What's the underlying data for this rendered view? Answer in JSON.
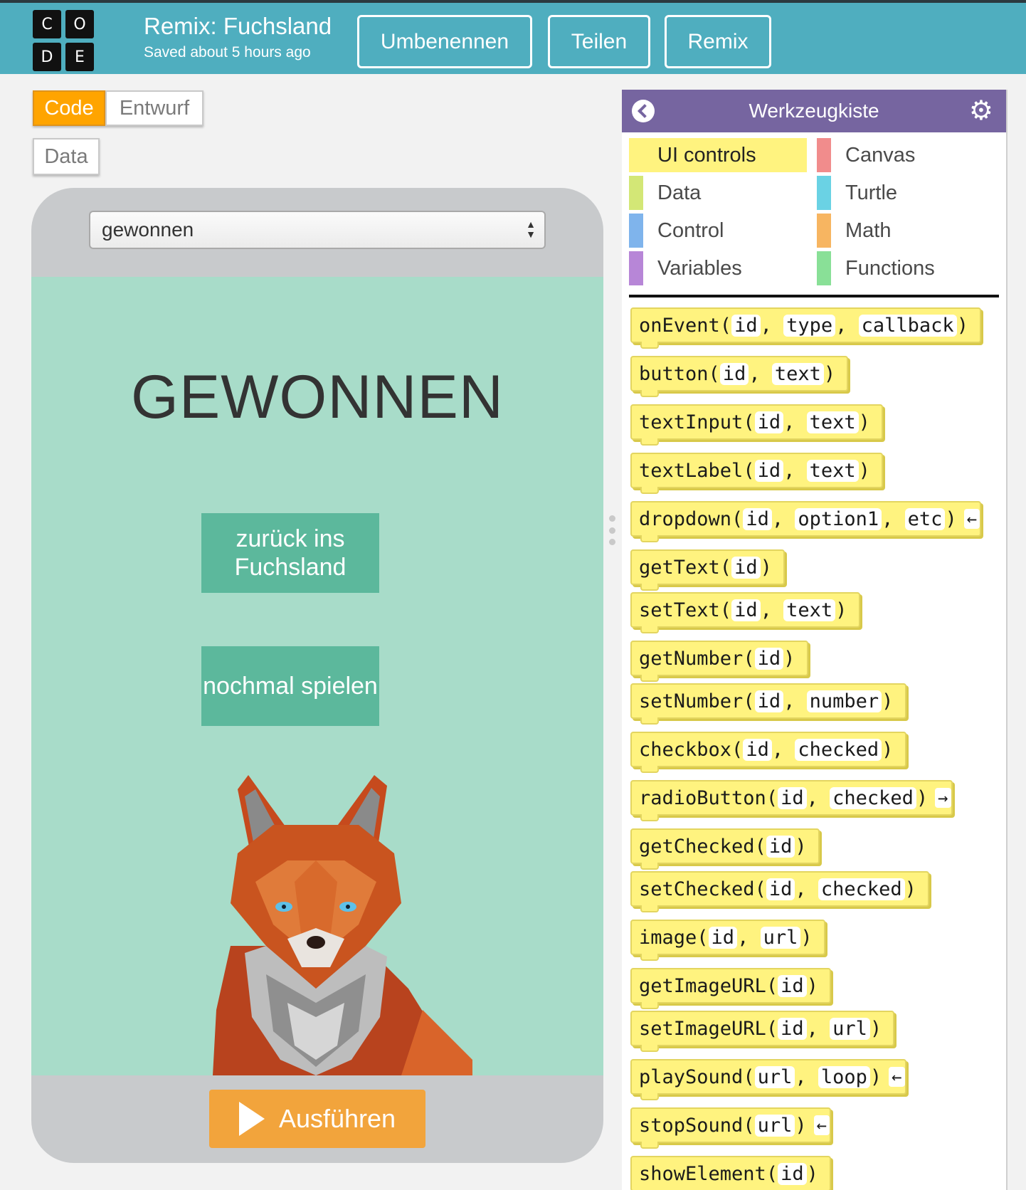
{
  "header": {
    "logo_letters": [
      "C",
      "O",
      "D",
      "E"
    ],
    "project_title": "Remix: Fuchsland",
    "saved_status": "Saved about 5 hours ago",
    "buttons": {
      "rename": "Umbenennen",
      "share": "Teilen",
      "remix": "Remix"
    }
  },
  "tabs": {
    "code": "Code",
    "design": "Entwurf",
    "data": "Data"
  },
  "phone": {
    "screen_select_value": "gewonnen",
    "app_title": "GEWONNEN",
    "back_button": "zurück ins Fuchsland",
    "replay_button": "nochmal spielen",
    "run_button": "Ausführen"
  },
  "toolbox": {
    "title": "Werkzeugkiste",
    "categories": [
      {
        "label": "UI controls",
        "color": "#fff37f",
        "selected": true
      },
      {
        "label": "Canvas",
        "color": "#f18c8c"
      },
      {
        "label": "Data",
        "color": "#d3e776"
      },
      {
        "label": "Turtle",
        "color": "#6ad2e4"
      },
      {
        "label": "Control",
        "color": "#7fb4ec"
      },
      {
        "label": "Math",
        "color": "#f7b561"
      },
      {
        "label": "Variables",
        "color": "#b786d7"
      },
      {
        "label": "Functions",
        "color": "#89e097"
      }
    ],
    "blocks": [
      {
        "name": "onEvent",
        "args": [
          "id",
          "type",
          "callback"
        ]
      },
      {
        "name": "button",
        "args": [
          "id",
          "text"
        ]
      },
      {
        "name": "textInput",
        "args": [
          "id",
          "text"
        ]
      },
      {
        "name": "textLabel",
        "args": [
          "id",
          "text"
        ]
      },
      {
        "name": "dropdown",
        "args": [
          "id",
          "option1",
          "etc"
        ],
        "ret": "←"
      },
      {
        "name": "getText",
        "args": [
          "id"
        ]
      },
      {
        "name": "setText",
        "args": [
          "id",
          "text"
        ]
      },
      {
        "name": "getNumber",
        "args": [
          "id"
        ]
      },
      {
        "name": "setNumber",
        "args": [
          "id",
          "number"
        ]
      },
      {
        "name": "checkbox",
        "args": [
          "id",
          "checked"
        ]
      },
      {
        "name": "radioButton",
        "args": [
          "id",
          "checked"
        ],
        "ret": "→"
      },
      {
        "name": "getChecked",
        "args": [
          "id"
        ]
      },
      {
        "name": "setChecked",
        "args": [
          "id",
          "checked"
        ]
      },
      {
        "name": "image",
        "args": [
          "id",
          "url"
        ]
      },
      {
        "name": "getImageURL",
        "args": [
          "id"
        ]
      },
      {
        "name": "setImageURL",
        "args": [
          "id",
          "url"
        ]
      },
      {
        "name": "playSound",
        "args": [
          "url",
          "loop"
        ],
        "ret": "←"
      },
      {
        "name": "stopSound",
        "args": [
          "url"
        ],
        "ret": "←"
      },
      {
        "name": "showElement",
        "args": [
          "id"
        ]
      }
    ]
  }
}
